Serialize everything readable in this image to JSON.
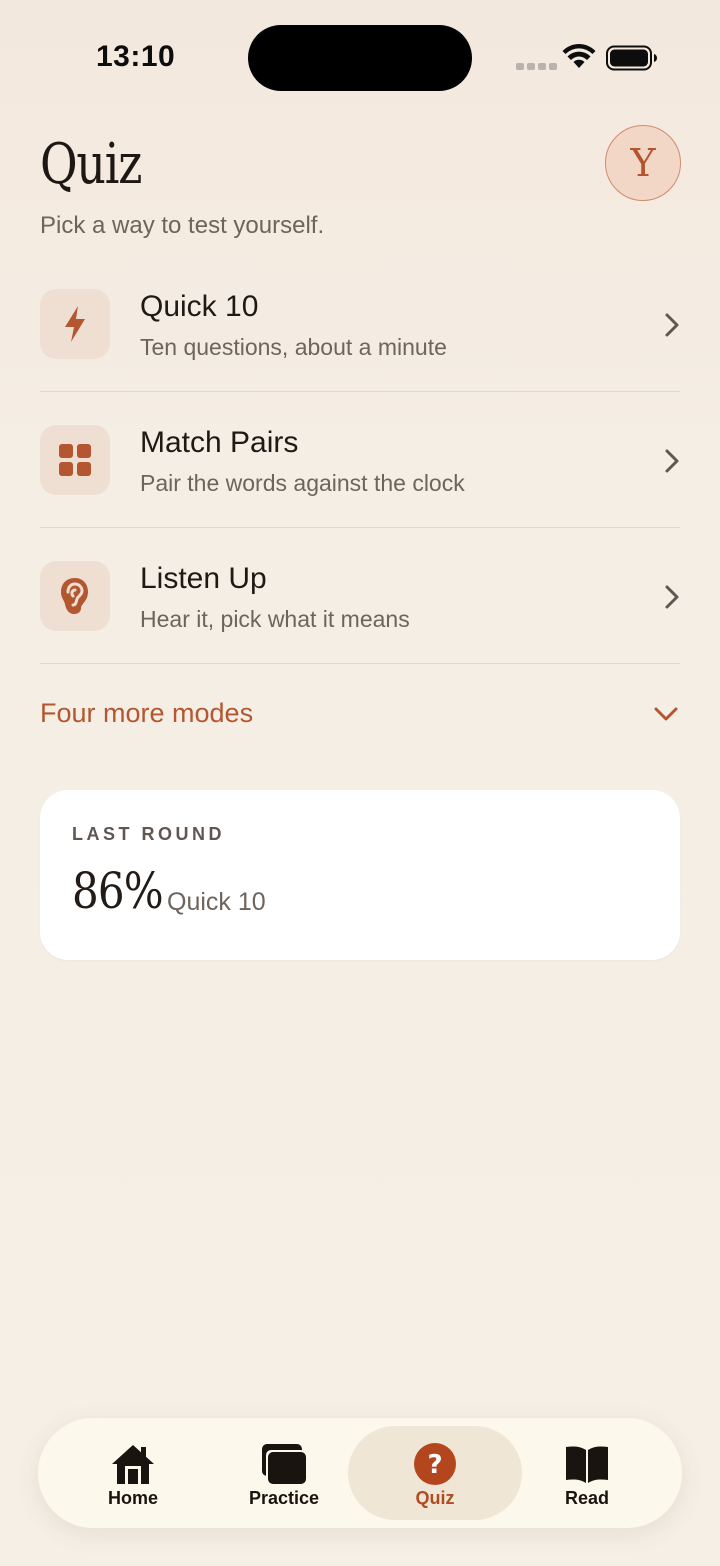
{
  "status_bar": {
    "time": "13:10"
  },
  "header": {
    "title": "Quiz",
    "subtitle": "Pick a way to test yourself.",
    "avatar_initial": "Y"
  },
  "modes": [
    {
      "title": "Quick 10",
      "description": "Ten questions, about a minute",
      "icon": "lightning-icon"
    },
    {
      "title": "Match Pairs",
      "description": "Pair the words against the clock",
      "icon": "grid-icon"
    },
    {
      "title": "Listen Up",
      "description": "Hear it, pick what it means",
      "icon": "ear-icon"
    }
  ],
  "more_modes": {
    "label": "Four more modes"
  },
  "last_round": {
    "label": "LAST ROUND",
    "score": "86%",
    "mode": "Quick 10"
  },
  "tab_bar": {
    "tabs": [
      {
        "label": "Home",
        "icon": "house-icon",
        "active": false
      },
      {
        "label": "Practice",
        "icon": "cards-icon",
        "active": false
      },
      {
        "label": "Quiz",
        "icon": "question-icon",
        "active": true
      },
      {
        "label": "Read",
        "icon": "book-icon",
        "active": false
      }
    ]
  },
  "colors": {
    "accent": "#b4562f",
    "background": "#f5efe6",
    "icon_tile": "#efdfd3",
    "card": "#ffffff"
  }
}
